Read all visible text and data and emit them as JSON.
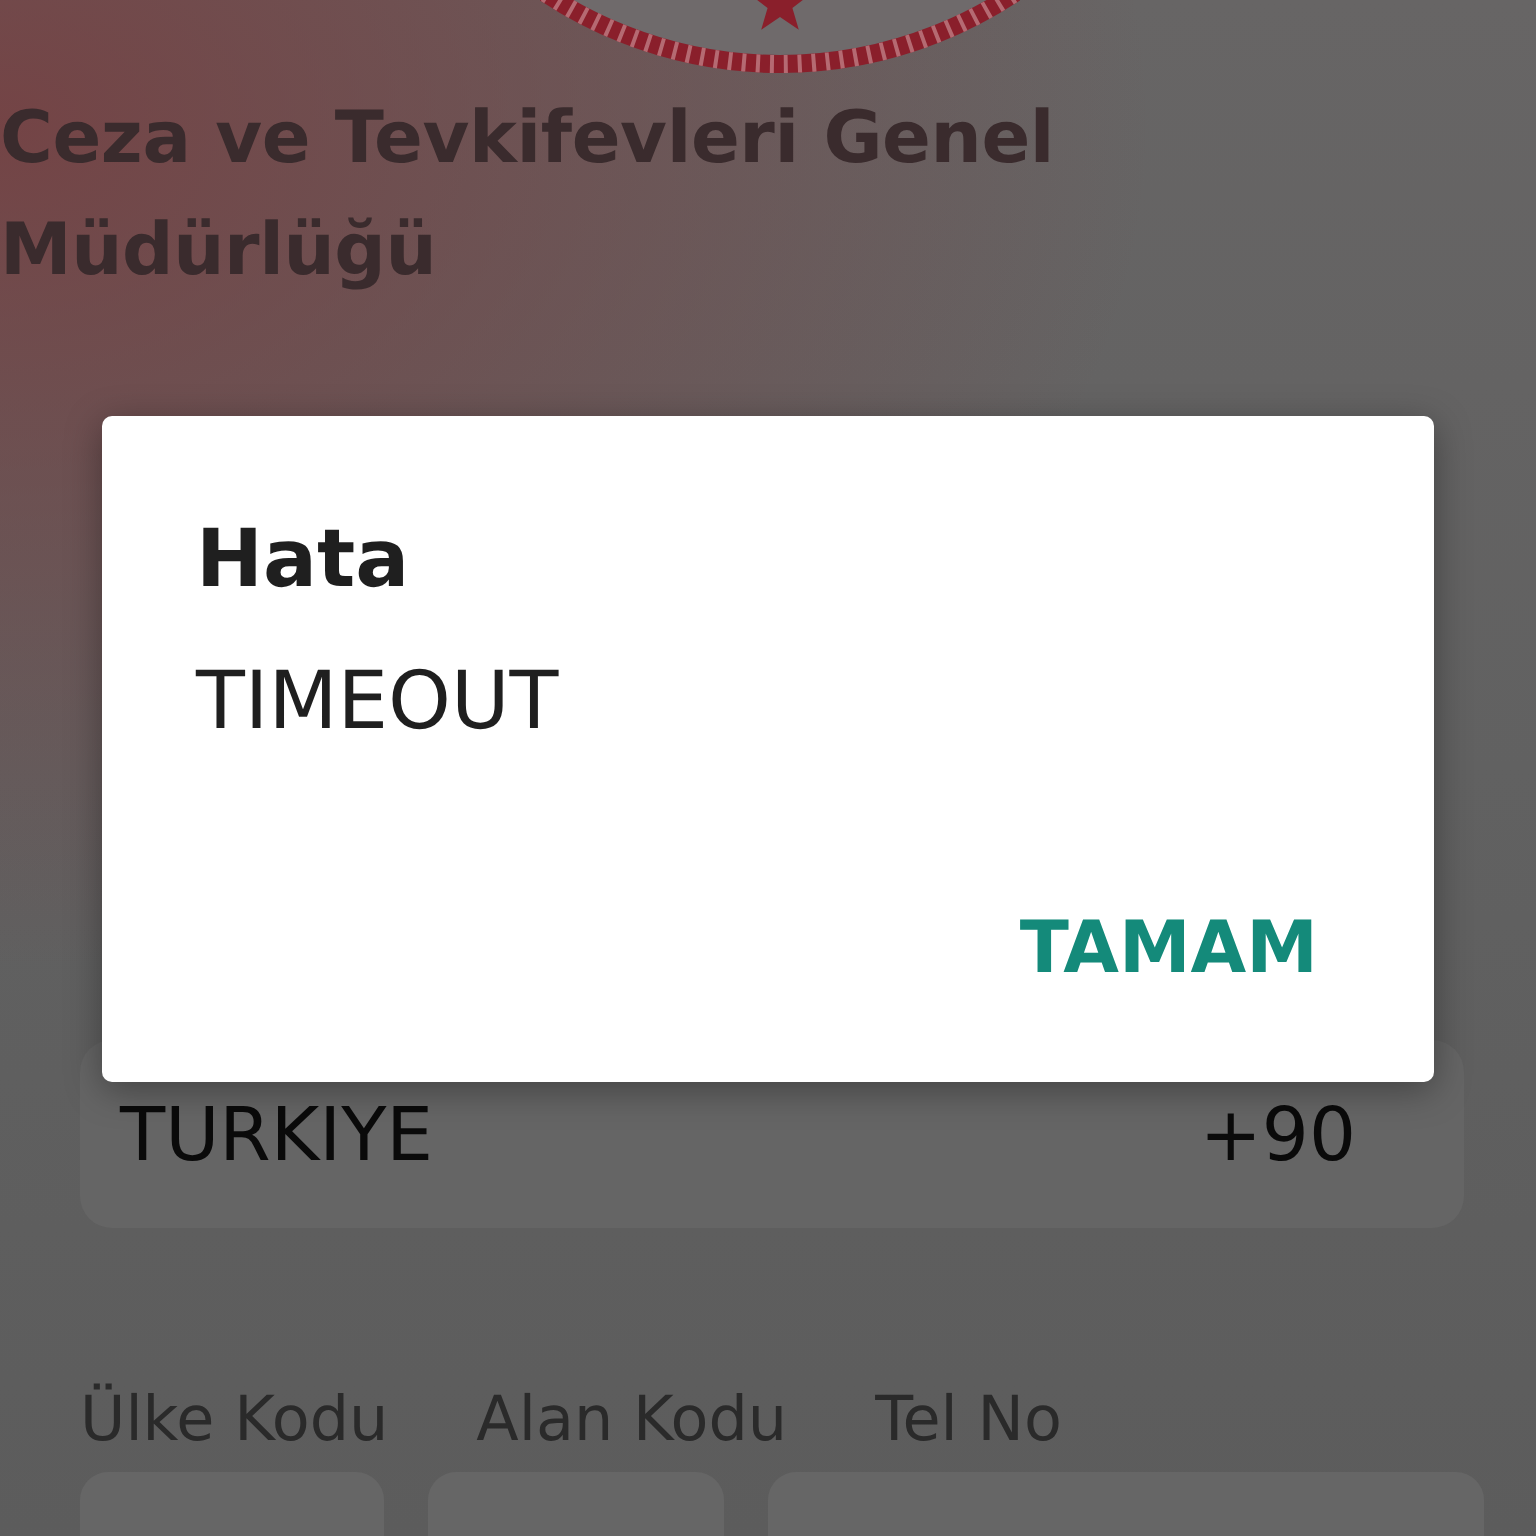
{
  "header": {
    "title": "Ceza ve Tevkifevleri Genel Müdürlüğü"
  },
  "country_field": {
    "value": "TURKIYE",
    "dial_code": "+90"
  },
  "phone_fields": [
    {
      "label": "Ülke Kodu"
    },
    {
      "label": "Alan Kodu"
    },
    {
      "label": "Tel No"
    }
  ],
  "dialog": {
    "title": "Hata",
    "message": "TIMEOUT",
    "buttons": [
      "TAMAM"
    ]
  }
}
